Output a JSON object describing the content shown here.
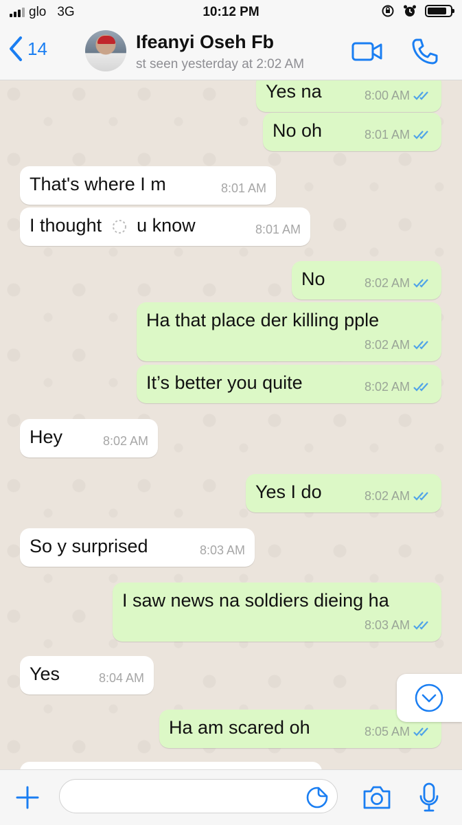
{
  "status_bar": {
    "carrier": "glo",
    "network": "3G",
    "time": "10:12 PM",
    "battery_level": 0.85
  },
  "header": {
    "back_count": "14",
    "contact_name": "Ifeanyi Oseh Fb",
    "last_seen": "st seen yesterday at 2:02 AM"
  },
  "messages": [
    {
      "dir": "out",
      "text": "Yes na",
      "time": "8:00 AM",
      "status": "read"
    },
    {
      "dir": "out",
      "text": "No oh",
      "time": "8:01 AM",
      "status": "read"
    },
    {
      "dir": "in",
      "text": "That's where I m",
      "time": "8:01 AM"
    },
    {
      "dir": "in",
      "text_before": "I thought",
      "emoji": "loading-spinner-icon",
      "text_after": "u know",
      "time": "8:01 AM"
    },
    {
      "dir": "out",
      "text": "No",
      "time": "8:02 AM",
      "status": "read"
    },
    {
      "dir": "out",
      "text": "Ha that place der killing pple",
      "time": "8:02 AM",
      "status": "read"
    },
    {
      "dir": "out",
      "text": "It’s better you quite",
      "time": "8:02 AM",
      "status": "read"
    },
    {
      "dir": "in",
      "text": "Hey",
      "time": "8:02 AM"
    },
    {
      "dir": "out",
      "text": "Yes I do",
      "time": "8:02 AM",
      "status": "read"
    },
    {
      "dir": "in",
      "text": "So y surprised",
      "time": "8:03 AM"
    },
    {
      "dir": "out",
      "text": "I saw news na soldiers dieing ha",
      "time": "8:03 AM",
      "status": "read"
    },
    {
      "dir": "in",
      "text": "Yes",
      "time": "8:04 AM"
    },
    {
      "dir": "out",
      "text": "Ha am scared oh",
      "time": "8:05 AM",
      "status": "read"
    }
  ],
  "input": {
    "placeholder": "",
    "value": ""
  },
  "colors": {
    "accent": "#1a7ef2",
    "outgoing_bubble": "#dcf8c6",
    "incoming_bubble": "#ffffff",
    "read_ticks": "#4fa3e8",
    "chat_background": "#ebe4dc"
  },
  "icons": {
    "back": "chevron-left-icon",
    "video": "video-camera-icon",
    "call": "phone-icon",
    "scroll_down": "chevron-down-circle-icon",
    "add": "plus-icon",
    "sticker": "sticker-icon",
    "camera": "camera-icon",
    "mic": "microphone-icon"
  }
}
